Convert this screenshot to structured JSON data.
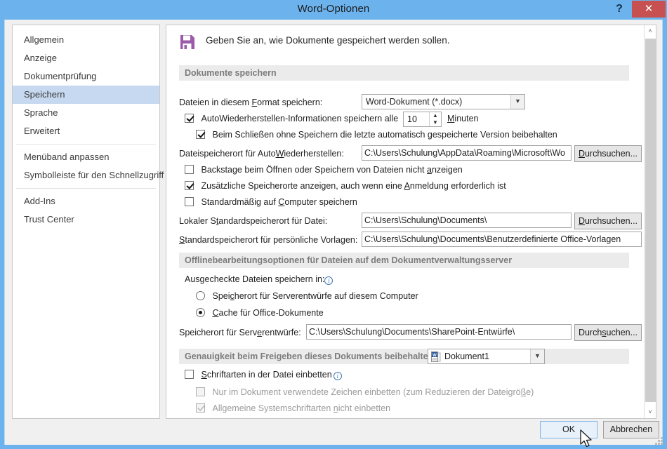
{
  "window": {
    "title": "Word-Optionen",
    "help_label": "?",
    "close_label": "✕"
  },
  "sidebar": {
    "items": [
      {
        "label": "Allgemein",
        "selected": false
      },
      {
        "label": "Anzeige",
        "selected": false
      },
      {
        "label": "Dokumentprüfung",
        "selected": false
      },
      {
        "label": "Speichern",
        "selected": true
      },
      {
        "label": "Sprache",
        "selected": false
      },
      {
        "label": "Erweitert",
        "selected": false
      },
      {
        "label": "Menüband anpassen",
        "selected": false
      },
      {
        "label": "Symbolleiste für den Schnellzugriff",
        "selected": false
      },
      {
        "label": "Add-Ins",
        "selected": false
      },
      {
        "label": "Trust Center",
        "selected": false
      }
    ]
  },
  "pane": {
    "header_text": "Geben Sie an, wie Dokumente gespeichert werden sollen.",
    "save_icon": "floppy-disk-icon",
    "section1_title": "Dokumente speichern",
    "section2_title": "Offlinebearbeitungsoptionen für Dateien auf dem Dokumentverwaltungsserver",
    "section3_title": "Genauigkeit beim Freigeben dieses Dokuments beibehalten:",
    "format_label": "Dateien in diesem Format speichern:",
    "format_value": "Word-Dokument (*.docx)",
    "autorecover_label": "AutoWiederherstellen-Informationen speichern alle",
    "autorecover_checked": true,
    "autorecover_minutes": "10",
    "minutes_label": "Minuten",
    "keep_last_label": "Beim Schließen ohne Speichern die letzte automatisch gespeicherte Version beibehalten",
    "keep_last_checked": true,
    "autorecover_path_label": "Dateispeicherort für AutoWiederherstellen:",
    "autorecover_path_value": "C:\\Users\\Schulung\\AppData\\Roaming\\Microsoft\\Wo",
    "browse_label": "Durchsuchen...",
    "no_backstage_label": "Backstage beim Öffnen oder Speichern von Dateien nicht anzeigen",
    "no_backstage_checked": false,
    "extra_places_label": "Zusätzliche Speicherorte anzeigen, auch wenn eine Anmeldung erforderlich ist",
    "extra_places_checked": true,
    "save_to_computer_label": "Standardmäßig auf Computer speichern",
    "save_to_computer_checked": false,
    "local_default_label": "Lokaler Standardspeicherort für Datei:",
    "local_default_value": "C:\\Users\\Schulung\\Documents\\",
    "personal_templates_label": "Standardspeicherort für persönliche Vorlagen:",
    "personal_templates_value": "C:\\Users\\Schulung\\Documents\\Benutzerdefinierte Office-Vorlagen",
    "checkout_label": "Ausgecheckte Dateien speichern in:",
    "checkout_info_icon": "info-icon",
    "radio1_label": "Speicherort für Serverentwürfe auf diesem Computer",
    "radio1_checked": false,
    "radio2_label": "Cache für Office-Dokumente",
    "radio2_checked": true,
    "server_drafts_label": "Speicherort für Serverentwürfe:",
    "server_drafts_value": "C:\\Users\\Schulung\\Documents\\SharePoint-Entwürfe\\",
    "document_select_value": "Dokument1",
    "document_icon": "word-document-icon",
    "embed_fonts_label": "Schriftarten in der Datei einbetten",
    "embed_fonts_checked": false,
    "embed_fonts_info_icon": "info-icon",
    "embed_used_only_label": "Nur im Dokument verwendete Zeichen einbetten (zum Reduzieren der Dateigröße)",
    "embed_used_only_checked": false,
    "no_system_fonts_label": "Allgemeine Systemschriftarten nicht einbetten",
    "no_system_fonts_checked": true
  },
  "footer": {
    "ok_label": "OK",
    "cancel_label": "Abbrechen"
  },
  "scrollbar": {
    "up_arrow": "˄",
    "down_arrow": "˅"
  },
  "colors": {
    "titlebar": "#6cb3ee",
    "close_button": "#c75050",
    "selection": "#c6d9f0",
    "accent_icon": "#9a5ba8",
    "section_header_text": "#7b7b7b"
  }
}
